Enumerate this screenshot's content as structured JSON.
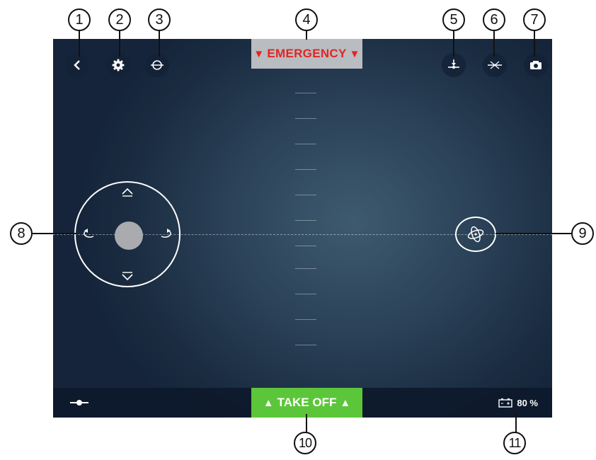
{
  "emergency": {
    "label": "EMERGENCY",
    "left_arrow": "▼",
    "right_arrow": "▼",
    "color": "#e52421"
  },
  "takeoff": {
    "label": "TAKE OFF",
    "left_arrow": "▲",
    "right_arrow": "▲",
    "color": "#5cc63a"
  },
  "battery": {
    "value": "80 %"
  },
  "toolbar": {
    "left": [
      {
        "name": "back-icon"
      },
      {
        "name": "gear-icon"
      },
      {
        "name": "calibration-icon"
      }
    ],
    "right": [
      {
        "name": "flat-trim-icon"
      },
      {
        "name": "hover-mode-icon"
      },
      {
        "name": "camera-icon"
      }
    ]
  },
  "callouts": [
    "1",
    "2",
    "3",
    "4",
    "5",
    "6",
    "7",
    "8",
    "9",
    "10",
    "11"
  ],
  "colors": {
    "background": "#1b2d42",
    "bar": "#0c182a"
  }
}
